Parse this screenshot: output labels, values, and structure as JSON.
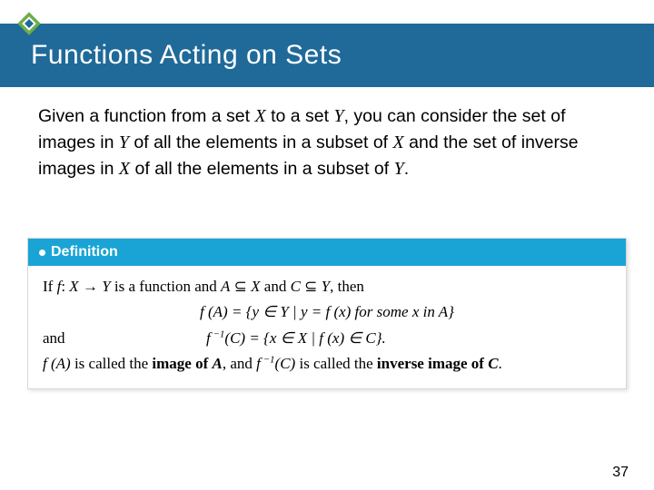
{
  "header": {
    "title": "Functions Acting on Sets",
    "icon": "diamond-icon"
  },
  "paragraph": {
    "pre1": "Given a function from a set ",
    "X1": "X",
    "mid1": " to a set ",
    "Y1": "Y",
    "mid2": ", you can consider the set of images in ",
    "Y2": "Y",
    "mid3": " of all the elements in a subset of ",
    "X2": "X",
    "mid4": " and the set of inverse images in ",
    "X3": "X",
    "mid5": " of all the elements in a subset of ",
    "Y3": "Y",
    "end": "."
  },
  "definition": {
    "label": "Definition",
    "line1_a": "If ",
    "line1_f": "f",
    "line1_b": ": ",
    "line1_X": "X",
    "line1_arrow": " → ",
    "line1_Y": "Y",
    "line1_c": " is a function and ",
    "line1_A": "A",
    "line1_sub1": " ⊆ ",
    "line1_X2": "X",
    "line1_and": " and ",
    "line1_C": "C",
    "line1_sub2": " ⊆ ",
    "line1_Y2": "Y",
    "line1_then": ", then",
    "eq1": "f (A) = {y ∈ Y | y = f (x) for some x in A}",
    "and_word": "and",
    "eq2_a": "f",
    "eq2_sup": " −1",
    "eq2_b": "(C) = {x ∈ X | f (x) ∈ C}.",
    "line3_a": "f (A)",
    "line3_b": " is called the ",
    "line3_bold1": "image of ",
    "line3_boldA": "A",
    "line3_c": ", and ",
    "line3_d": "f",
    "line3_sup": " −1",
    "line3_e": "(C)",
    "line3_f": " is called the ",
    "line3_bold2": "inverse image of ",
    "line3_boldC": "C",
    "line3_g": "."
  },
  "page_number": "37"
}
